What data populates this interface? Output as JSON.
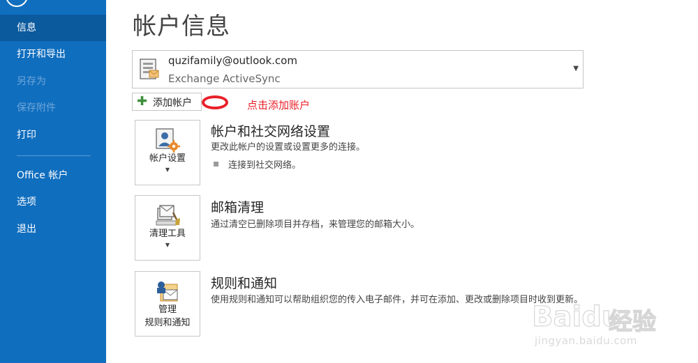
{
  "sidebar": {
    "items": [
      {
        "label": "信息",
        "state": "active"
      },
      {
        "label": "打开和导出",
        "state": "normal"
      },
      {
        "label": "另存为",
        "state": "disabled"
      },
      {
        "label": "保存附件",
        "state": "disabled"
      },
      {
        "label": "打印",
        "state": "normal"
      },
      {
        "label": "Office 帐户",
        "state": "normal"
      },
      {
        "label": "选项",
        "state": "normal"
      },
      {
        "label": "退出",
        "state": "normal"
      }
    ],
    "back_icon": "back-arrow-circle-icon"
  },
  "main": {
    "title": "帐户信息",
    "account": {
      "email": "quzifamily@outlook.com",
      "type": "Exchange ActiveSync"
    },
    "add_account_label": "添加帐户",
    "annotation": "点击添加账户",
    "sections": [
      {
        "tile_label": "帐户设置",
        "title": "帐户和社交网络设置",
        "desc": "更改此帐户的设置或设置更多的连接。",
        "bullet": "连接到社交网络。"
      },
      {
        "tile_label": "清理工具",
        "title": "邮箱清理",
        "desc": "通过清空已删除项目并存档，来管理您的邮箱大小。"
      },
      {
        "tile_label_line1": "管理",
        "tile_label_line2": "规则和通知",
        "title": "规则和通知",
        "desc": "使用规则和通知可以帮助组织您的传入电子邮件，并可在添加、更改或删除项目时收到更新。"
      }
    ]
  },
  "watermark": {
    "logo_text": "Bai",
    "logo_text2": "du",
    "brand": "经验",
    "url": "jingyan.baidu.com"
  },
  "colors": {
    "sidebar_bg": "#106ebe",
    "sidebar_active": "#0b5a9e",
    "annotation_red": "#e8202a"
  }
}
